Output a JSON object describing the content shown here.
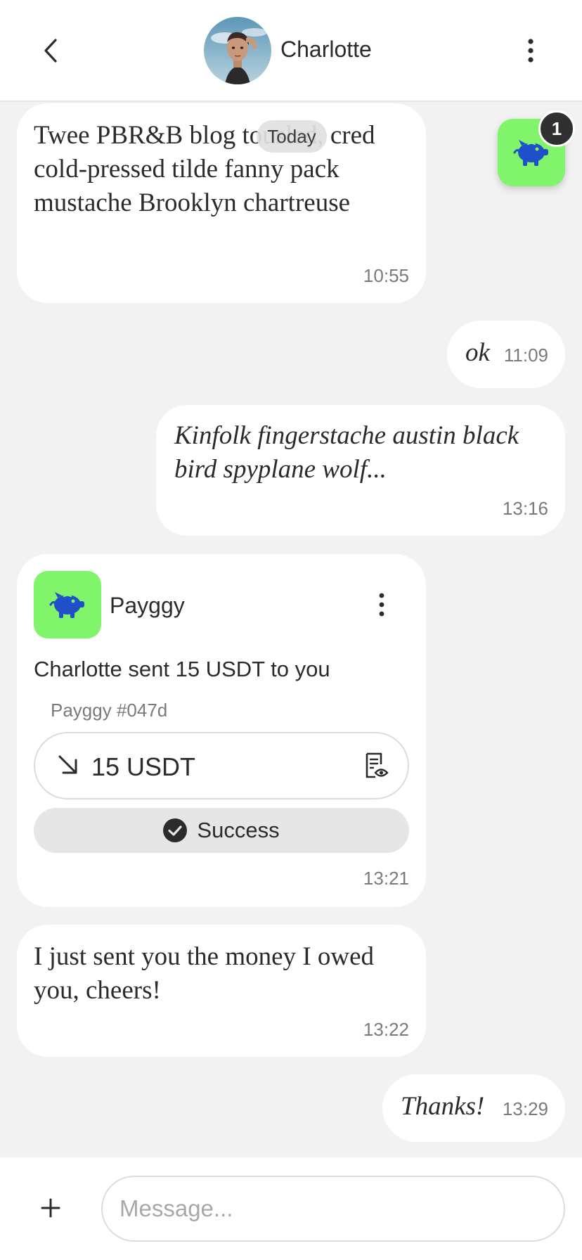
{
  "header": {
    "back_icon": "chevron-left-icon",
    "contact_name": "Charlotte",
    "menu_icon": "more-vertical-icon"
  },
  "chat": {
    "date_separator": "Today",
    "floating_app": {
      "icon": "piggy-bank-icon",
      "badge_count": "1"
    },
    "messages": [
      {
        "direction": "incoming",
        "style": "normal",
        "text": "Twee PBR&B blog tousled, cred cold-pressed tilde fanny pack mustache Brooklyn chartreuse",
        "time": "10:55"
      },
      {
        "direction": "outgoing",
        "style": "italic",
        "text": "ok",
        "time": "11:09"
      },
      {
        "direction": "outgoing",
        "style": "italic",
        "text": "Kinfolk fingerstache austin black bird spyplane wolf...",
        "time": "13:16"
      },
      {
        "direction": "incoming",
        "style": "normal",
        "text": "I just sent you the money I owed you, cheers!",
        "time": "13:22"
      },
      {
        "direction": "outgoing",
        "style": "italic",
        "text": "Thanks!",
        "time": "13:29"
      }
    ],
    "payment_card": {
      "app_name": "Payggy",
      "app_icon": "piggy-bank-icon",
      "description": "Charlotte sent 15 USDT to you",
      "reference": "Payggy #047d",
      "amount": "15 USDT",
      "amount_icon": "arrow-down-right-icon",
      "receipt_icon": "receipt-view-icon",
      "status": "Success",
      "status_icon": "check-circle-icon",
      "time": "13:21"
    }
  },
  "composer": {
    "add_icon": "plus-icon",
    "placeholder": "Message..."
  },
  "colors": {
    "accent_green": "#80f56b",
    "pig_blue": "#1f50c9",
    "background": "#f2f2f2",
    "bubble": "#ffffff"
  }
}
